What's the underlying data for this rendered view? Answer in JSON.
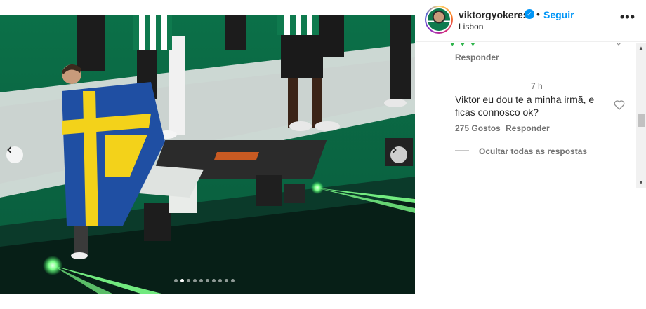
{
  "post": {
    "username": "viktorgyokeres",
    "verified_mark": "✓",
    "separator": "•",
    "follow_label": "Seguir",
    "location": "Lisbon",
    "more_label": "•••"
  },
  "carousel": {
    "prev_icon": "chevron-left-icon",
    "next_icon": "chevron-right-icon",
    "slide_count": 10,
    "active_index": 1
  },
  "comments": {
    "partial_comment_emojis": "♥♥♥",
    "partial_comment_reply": "Responder",
    "reply_time": "7 h",
    "reply_text": "Viktor eu dou te a minha irmã, e ficas connosco ok?",
    "reply_likes": "275 Gostos",
    "reply_action": "Responder",
    "hide_replies": "Ocultar todas as respostas"
  },
  "scrollbar": {
    "up_arrow": "▲",
    "down_arrow": "▼"
  },
  "colors": {
    "accent": "#0095f6",
    "field_green": "#0d6a45",
    "laser_green": "#7dff8a",
    "flag_blue": "#1f4fa3",
    "flag_yellow": "#f3d21a"
  }
}
